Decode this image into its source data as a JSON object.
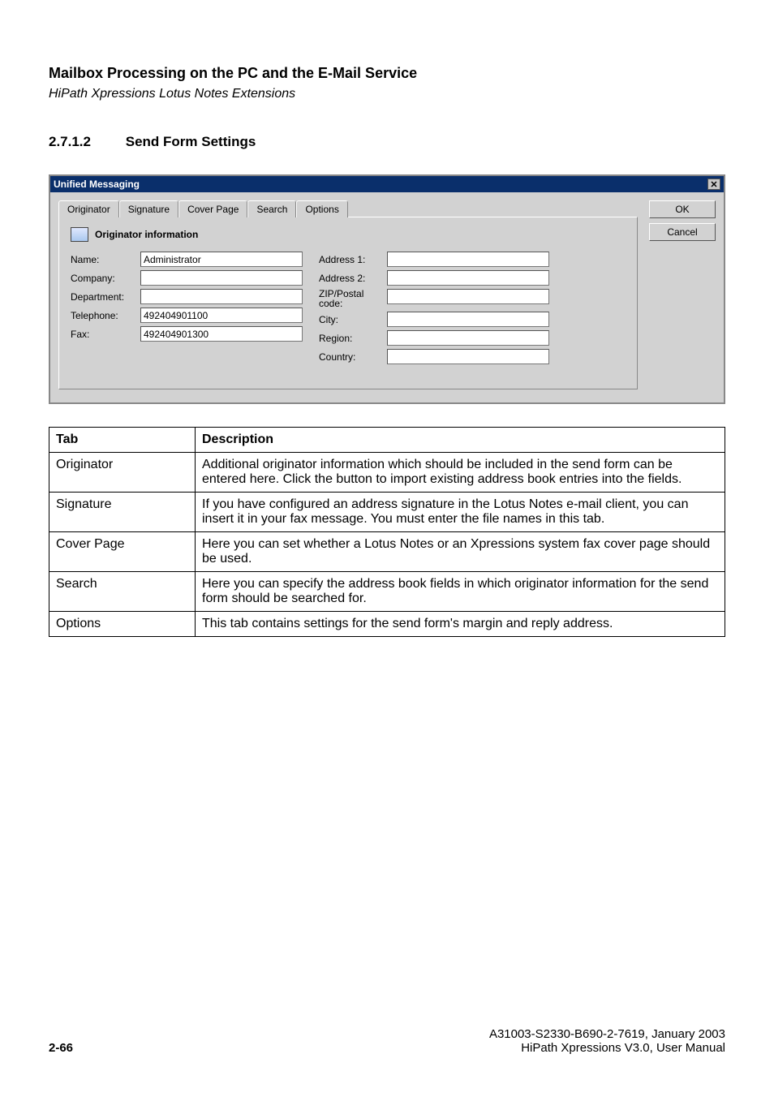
{
  "header": {
    "title": "Mailbox Processing on the PC and the E-Mail Service",
    "subtitle": "HiPath Xpressions Lotus Notes Extensions"
  },
  "section": {
    "number": "2.7.1.2",
    "title": "Send Form Settings"
  },
  "dialog": {
    "title": "Unified Messaging",
    "ok": "OK",
    "cancel": "Cancel",
    "tabs": {
      "originator": "Originator",
      "signature": "Signature",
      "coverpage": "Cover Page",
      "search": "Search",
      "options": "Options"
    },
    "panel_header": "Originator information",
    "left_labels": {
      "name": "Name:",
      "company": "Company:",
      "department": "Department:",
      "telephone": "Telephone:",
      "fax": "Fax:"
    },
    "right_labels": {
      "address1": "Address 1:",
      "address2": "Address 2:",
      "zip": "ZIP/Postal code:",
      "city": "City:",
      "region": "Region:",
      "country": "Country:"
    },
    "values": {
      "name": "Administrator",
      "company": "",
      "department": "",
      "telephone": "492404901100",
      "fax": "492404901300",
      "address1": "",
      "address2": "",
      "zip": "",
      "city": "",
      "region": "",
      "country": ""
    }
  },
  "table": {
    "head_tab": "Tab",
    "head_desc": "Description",
    "rows": [
      {
        "tab": "Originator",
        "desc": "Additional originator information which should be included in the send form can be entered here. Click the button to import existing address book entries into the fields."
      },
      {
        "tab": "Signature",
        "desc": "If you have configured an address signature in the Lotus Notes e-mail client, you can insert it in your fax message. You must enter the file names in this tab."
      },
      {
        "tab": "Cover Page",
        "desc": "Here you can set whether a Lotus Notes or an Xpressions system fax cover page should be used."
      },
      {
        "tab": "Search",
        "desc": "Here you can specify the address book fields in which originator information for the send form should be searched for."
      },
      {
        "tab": "Options",
        "desc": "This tab contains settings for the send form's margin and reply address."
      }
    ]
  },
  "footer": {
    "page_num": "2-66",
    "docid": "A31003-S2330-B690-2-7619, January 2003",
    "doc": "HiPath Xpressions V3.0, User Manual"
  }
}
